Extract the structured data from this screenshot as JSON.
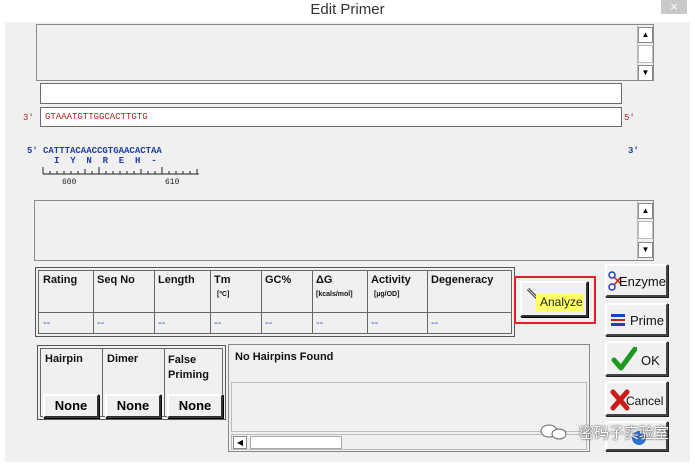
{
  "window": {
    "title": "Edit Primer",
    "close_glyph": "×"
  },
  "sequence": {
    "primer_3prime_label": "3'",
    "primer_5prime_label": "5'",
    "primer_input": "GTAAATGTTGGCACTTGTG",
    "template_5prime_label": "5'",
    "template_seq": "CATTTACAACCGTGAACACTAA",
    "template_3prime_label": "3'",
    "translation": "I  Y  N  R  E  H  -",
    "ruler_labels": [
      "600",
      "610"
    ]
  },
  "results_table": {
    "headers": [
      "Rating",
      "Seq No",
      "Length",
      "Tm",
      "GC%",
      "ΔG",
      "Activity",
      "Degeneracy"
    ],
    "subheaders": [
      "",
      "",
      "",
      "[ºC]",
      "",
      "[kcals/mol]",
      "[µg/OD]",
      ""
    ],
    "values": [
      "--",
      "--",
      "--",
      "--",
      "--",
      "--",
      "--",
      "--"
    ]
  },
  "buttons": {
    "analyze": "Analyze",
    "enzyme": "Enzyme",
    "prime": "Prime",
    "ok": "OK",
    "cancel": "Cancel"
  },
  "secondary": {
    "headers": [
      "Hairpin",
      "Dimer",
      "False Priming"
    ],
    "values": [
      "None",
      "None",
      "None"
    ],
    "status": "No Hairpins Found"
  },
  "watermark": "密码子实验室",
  "colors": {
    "accent_red": "#e02020",
    "sequence_red": "#b22222",
    "sequence_blue": "#1f3f9f"
  }
}
